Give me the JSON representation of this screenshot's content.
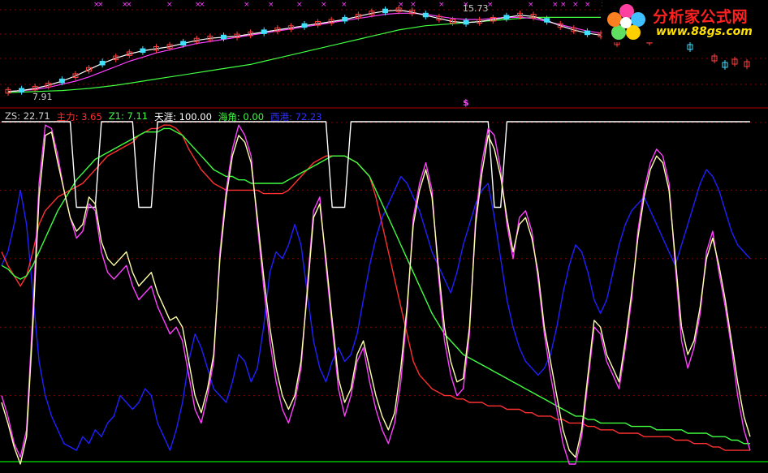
{
  "logo": {
    "title": "分析家公式网",
    "url": "www.88gs.com"
  },
  "price_pane": {
    "high_label": "15.73",
    "low_label": "7.91",
    "signal_marker": "$",
    "colors": {
      "up": "#ff4040",
      "down": "#40e0ff",
      "ma_short": "#ffffff",
      "ma_mid": "#ff40ff",
      "ma_long": "#40ff40",
      "marker": "#ff40ff"
    }
  },
  "indicator_pane": {
    "legend": [
      {
        "key": "ZS",
        "label": "ZS: 22.71",
        "color": "#d0d0d0"
      },
      {
        "key": "主力",
        "label": "主力: 3.65",
        "color": "#ff3030"
      },
      {
        "key": "Z1",
        "label": "Z1: 7.11",
        "color": "#40ff40"
      },
      {
        "key": "天涯",
        "label": "天涯: 100.00",
        "color": "#ffffff"
      },
      {
        "key": "海角",
        "label": "海角: 0.00",
        "color": "#40ff40"
      },
      {
        "key": "西港",
        "label": "西港: 72.23",
        "color": "#3030ff"
      }
    ]
  },
  "chart_data": {
    "type": "line",
    "title": "",
    "ylim": [
      0,
      100
    ],
    "x": [
      0,
      1,
      2,
      3,
      4,
      5,
      6,
      7,
      8,
      9,
      10,
      11,
      12,
      13,
      14,
      15,
      16,
      17,
      18,
      19,
      20,
      21,
      22,
      23,
      24,
      25,
      26,
      27,
      28,
      29,
      30,
      31,
      32,
      33,
      34,
      35,
      36,
      37,
      38,
      39,
      40,
      41,
      42,
      43,
      44,
      45,
      46,
      47,
      48,
      49,
      50,
      51,
      52,
      53,
      54,
      55,
      56,
      57,
      58,
      59,
      60,
      61,
      62,
      63,
      64,
      65,
      66,
      67,
      68,
      69,
      70,
      71,
      72,
      73,
      74,
      75,
      76,
      77,
      78,
      79,
      80,
      81,
      82,
      83,
      84,
      85,
      86,
      87,
      88,
      89,
      90,
      91,
      92,
      93,
      94,
      95,
      96,
      97,
      98,
      99,
      100,
      101,
      102,
      103,
      104,
      105,
      106,
      107,
      108,
      109,
      110,
      111,
      112,
      113,
      114,
      115,
      116,
      117,
      118,
      119,
      120
    ],
    "series": [
      {
        "name": "天涯",
        "color": "#ffffff",
        "values": [
          100,
          100,
          100,
          100,
          100,
          100,
          100,
          100,
          100,
          100,
          100,
          100,
          75,
          75,
          75,
          75,
          100,
          100,
          100,
          100,
          100,
          100,
          75,
          75,
          75,
          100,
          100,
          100,
          100,
          100,
          100,
          100,
          100,
          100,
          100,
          100,
          100,
          100,
          100,
          100,
          100,
          100,
          100,
          100,
          100,
          100,
          100,
          100,
          100,
          100,
          100,
          100,
          100,
          75,
          75,
          75,
          100,
          100,
          100,
          100,
          100,
          100,
          100,
          100,
          100,
          100,
          100,
          100,
          100,
          100,
          100,
          100,
          100,
          100,
          100,
          100,
          100,
          100,
          100,
          75,
          75,
          100,
          100,
          100,
          100,
          100,
          100,
          100,
          100,
          100,
          100,
          100,
          100,
          100,
          100,
          100,
          100,
          100,
          100,
          100,
          100,
          100,
          100,
          100,
          100,
          100,
          100,
          100,
          100,
          100,
          100,
          100,
          100,
          100,
          100,
          100,
          100,
          100,
          100,
          100,
          100
        ]
      },
      {
        "name": "ZS",
        "color": "#ffffaa",
        "values": [
          18,
          12,
          5,
          0,
          8,
          40,
          78,
          96,
          97,
          88,
          80,
          72,
          68,
          70,
          78,
          76,
          65,
          60,
          58,
          60,
          62,
          56,
          52,
          54,
          56,
          50,
          46,
          42,
          43,
          40,
          30,
          20,
          15,
          22,
          32,
          60,
          78,
          90,
          96,
          94,
          88,
          72,
          55,
          40,
          28,
          20,
          16,
          20,
          30,
          50,
          72,
          76,
          60,
          42,
          25,
          18,
          22,
          32,
          36,
          28,
          20,
          14,
          10,
          15,
          28,
          46,
          70,
          80,
          86,
          78,
          58,
          40,
          30,
          24,
          25,
          40,
          70,
          85,
          96,
          92,
          84,
          72,
          62,
          70,
          72,
          66,
          56,
          40,
          30,
          20,
          10,
          4,
          2,
          10,
          26,
          42,
          40,
          32,
          28,
          24,
          36,
          50,
          66,
          78,
          86,
          90,
          88,
          80,
          60,
          40,
          32,
          36,
          46,
          60,
          66,
          58,
          48,
          36,
          24,
          14,
          8
        ]
      },
      {
        "name": "主力",
        "color": "#ff3030",
        "values": [
          62,
          58,
          55,
          52,
          55,
          62,
          70,
          74,
          76,
          78,
          79,
          80,
          81,
          82,
          84,
          86,
          88,
          90,
          91,
          92,
          93,
          94,
          96,
          97,
          98,
          98,
          99,
          99,
          98,
          96,
          92,
          89,
          86,
          84,
          82,
          81,
          80,
          80,
          80,
          80,
          80,
          80,
          79,
          79,
          79,
          79,
          80,
          82,
          84,
          86,
          88,
          89,
          90,
          90,
          90,
          90,
          89,
          88,
          86,
          84,
          78,
          70,
          62,
          54,
          46,
          38,
          30,
          26,
          24,
          22,
          21,
          20,
          20,
          19,
          19,
          18,
          18,
          18,
          17,
          17,
          17,
          16,
          16,
          16,
          15,
          15,
          14,
          14,
          14,
          13,
          13,
          12,
          12,
          12,
          11,
          11,
          10,
          10,
          10,
          9,
          9,
          9,
          9,
          8,
          8,
          8,
          8,
          8,
          7,
          7,
          7,
          6,
          6,
          6,
          5,
          5,
          4,
          4,
          4,
          4,
          4
        ]
      },
      {
        "name": "Z1",
        "color": "#40ff40",
        "values": [
          58,
          57,
          55,
          54,
          55,
          58,
          62,
          66,
          70,
          74,
          77,
          80,
          83,
          85,
          87,
          89,
          90,
          91,
          92,
          93,
          94,
          95,
          96,
          97,
          97,
          97,
          98,
          98,
          97,
          96,
          94,
          92,
          90,
          88,
          86,
          85,
          84,
          84,
          83,
          83,
          82,
          82,
          82,
          82,
          82,
          82,
          83,
          84,
          85,
          86,
          87,
          88,
          89,
          90,
          90,
          90,
          89,
          88,
          86,
          84,
          80,
          76,
          72,
          68,
          64,
          60,
          56,
          52,
          48,
          44,
          41,
          38,
          36,
          34,
          32,
          31,
          30,
          29,
          28,
          27,
          26,
          25,
          24,
          23,
          22,
          21,
          20,
          19,
          18,
          17,
          16,
          15,
          14,
          14,
          13,
          13,
          12,
          12,
          12,
          12,
          12,
          11,
          11,
          11,
          11,
          10,
          10,
          10,
          10,
          10,
          9,
          9,
          9,
          9,
          8,
          8,
          8,
          7,
          7,
          6,
          6
        ]
      },
      {
        "name": "西港",
        "color": "#2020ff",
        "values": [
          58,
          62,
          70,
          80,
          70,
          50,
          30,
          20,
          14,
          10,
          6,
          5,
          4,
          8,
          6,
          10,
          8,
          12,
          14,
          20,
          18,
          16,
          18,
          22,
          20,
          12,
          8,
          4,
          10,
          18,
          30,
          38,
          34,
          28,
          22,
          20,
          18,
          24,
          32,
          30,
          24,
          28,
          40,
          56,
          62,
          60,
          64,
          70,
          64,
          50,
          36,
          28,
          24,
          30,
          34,
          30,
          32,
          38,
          48,
          58,
          66,
          72,
          76,
          80,
          84,
          82,
          78,
          74,
          68,
          62,
          58,
          54,
          50,
          56,
          64,
          70,
          76,
          80,
          82,
          72,
          60,
          48,
          40,
          34,
          30,
          28,
          26,
          28,
          32,
          40,
          50,
          58,
          64,
          62,
          56,
          48,
          44,
          48,
          56,
          64,
          70,
          74,
          76,
          78,
          74,
          70,
          66,
          62,
          58,
          64,
          70,
          76,
          82,
          86,
          84,
          80,
          74,
          68,
          64,
          62,
          60
        ]
      },
      {
        "name": "海角",
        "color": "#ff40ff",
        "values": [
          20,
          14,
          6,
          2,
          10,
          44,
          82,
          99,
          98,
          90,
          80,
          72,
          66,
          68,
          76,
          74,
          62,
          56,
          54,
          56,
          58,
          52,
          48,
          50,
          52,
          46,
          42,
          38,
          40,
          36,
          26,
          16,
          12,
          20,
          30,
          62,
          80,
          92,
          99,
          96,
          90,
          70,
          52,
          36,
          24,
          16,
          12,
          18,
          28,
          52,
          74,
          78,
          58,
          40,
          22,
          14,
          20,
          30,
          34,
          24,
          16,
          10,
          6,
          12,
          24,
          44,
          72,
          82,
          88,
          80,
          56,
          36,
          26,
          20,
          22,
          38,
          72,
          88,
          98,
          96,
          86,
          70,
          60,
          72,
          74,
          68,
          54,
          38,
          26,
          16,
          6,
          0,
          0,
          8,
          24,
          40,
          38,
          30,
          26,
          22,
          34,
          48,
          68,
          80,
          88,
          92,
          90,
          82,
          58,
          36,
          28,
          34,
          44,
          62,
          68,
          56,
          46,
          34,
          20,
          10,
          4
        ]
      }
    ],
    "price_series": {
      "ma_short": [
        7.9,
        8.0,
        8.2,
        8.5,
        8.9,
        9.4,
        10.0,
        10.6,
        11.1,
        11.5,
        11.8,
        12.0,
        12.2,
        12.5,
        12.8,
        13.0,
        13.1,
        13.2,
        13.4,
        13.6,
        13.8,
        14.0,
        14.2,
        14.4,
        14.6,
        14.8,
        15.1,
        15.4,
        15.6,
        15.7,
        15.5,
        15.2,
        14.9,
        14.6,
        14.5,
        14.6,
        14.8,
        15.0,
        15.2,
        15.1,
        14.7,
        14.2,
        13.8,
        13.5,
        13.3
      ],
      "ma_mid": [
        7.9,
        8.0,
        8.1,
        8.3,
        8.6,
        8.9,
        9.3,
        9.8,
        10.3,
        10.8,
        11.2,
        11.6,
        11.9,
        12.2,
        12.5,
        12.7,
        12.9,
        13.1,
        13.3,
        13.5,
        13.7,
        13.9,
        14.1,
        14.3,
        14.5,
        14.7,
        14.9,
        15.1,
        15.3,
        15.4,
        15.4,
        15.3,
        15.1,
        14.9,
        14.8,
        14.8,
        14.9,
        15.0,
        15.0,
        14.9,
        14.6,
        14.3,
        14.0,
        13.7,
        13.5
      ],
      "ma_long": [
        7.8,
        7.85,
        7.9,
        7.95,
        8.0,
        8.1,
        8.2,
        8.35,
        8.5,
        8.7,
        8.9,
        9.1,
        9.3,
        9.5,
        9.7,
        9.9,
        10.1,
        10.3,
        10.5,
        10.8,
        11.1,
        11.4,
        11.7,
        12.0,
        12.3,
        12.6,
        12.9,
        13.2,
        13.5,
        13.8,
        14.0,
        14.2,
        14.3,
        14.4,
        14.5,
        14.6,
        14.7,
        14.8,
        14.9,
        15.0,
        15.0,
        15.0,
        15.0,
        15.0,
        15.0
      ],
      "price_range": [
        7.5,
        16.2
      ]
    }
  }
}
